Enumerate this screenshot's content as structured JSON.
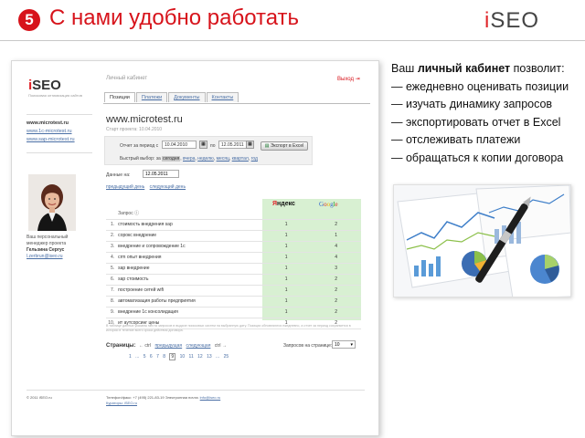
{
  "header": {
    "number": "❺",
    "title": "С нами удобно работать",
    "logo_prefix": "i",
    "logo_rest": "SEO"
  },
  "cabinet": {
    "logo_prefix": "i",
    "logo_rest": "SEO",
    "logo_sub": "Поисковая оптимизация сайтов",
    "cabinet_label": "Личный кабинет",
    "exit_label": "Выход",
    "tabs": [
      "Позиции",
      "Платежи",
      "Документы",
      "Контакты"
    ],
    "sidebar": {
      "sites": [
        "www.microtest.ru",
        "www.1c-microtest.ru",
        "www.sap-microtest.ru"
      ],
      "manager_role_1": "Ваш персональный",
      "manager_role_2": "менеджер проекта",
      "manager_name": "Гельзина Сергус",
      "manager_email": "l.zerbrun@iseo.ru"
    },
    "site_name": "www.microtest.ru",
    "start_label": "Старт проекта: 10.04.2010",
    "report": {
      "period_label": "Отчет за период с",
      "date_from": "10.04.2010",
      "to_label": "по",
      "date_to": "12.05.2011",
      "export_label": "Экспорт в Excel",
      "quick_label": "Быстрый выбор:",
      "quick_prefix": "за",
      "quick_options": [
        "сегодня",
        "вчера",
        "неделю",
        "месяц",
        "квартал",
        "год"
      ]
    },
    "data_label": "Данные на:",
    "data_date": "12.05.2011",
    "day_nav": [
      "предыдущий день",
      "следующий день"
    ],
    "table": {
      "col_query": "Запрос",
      "yandex_y": "Я",
      "yandex_rest": "ндекс",
      "google": [
        "G",
        "o",
        "o",
        "g",
        "l",
        "e"
      ],
      "rows": [
        {
          "num": "1.",
          "query": "стоимость внедрения sap",
          "yandex": "1",
          "google": "2"
        },
        {
          "num": "2.",
          "query": "сорокс внедрение",
          "yandex": "1",
          "google": "1"
        },
        {
          "num": "3.",
          "query": "внедрение и сопровождение 1с",
          "yandex": "1",
          "google": "4"
        },
        {
          "num": "4.",
          "query": "сrm опыт внедрения",
          "yandex": "1",
          "google": "4"
        },
        {
          "num": "5.",
          "query": "sap внедрение",
          "yandex": "1",
          "google": "3"
        },
        {
          "num": "6.",
          "query": "sap стоимость",
          "yandex": "1",
          "google": "2"
        },
        {
          "num": "7.",
          "query": "построение сетей wifi",
          "yandex": "1",
          "google": "2"
        },
        {
          "num": "8.",
          "query": "автоматизация работы предприятия",
          "yandex": "1",
          "google": "2"
        },
        {
          "num": "9.",
          "query": "внедрение 1с консолидация",
          "yandex": "1",
          "google": "2"
        },
        {
          "num": "10.",
          "query": "ит аутсорсинг цены",
          "yandex": "1",
          "google": "2"
        }
      ]
    },
    "footnote": "В таблице данных указаны места запросов в выдаче поисковых систем на выбранную дату. Позиции обновляются ежедневно, а отчет за период сохраняется в истории в течение всего срока действия договора.",
    "pagination": {
      "label": "Страницы:",
      "prev_arrow": "← ctrl",
      "prev": "предыдущая",
      "next": "следующая",
      "next_arrow": "ctrl →",
      "pages": "1 ... 5 6 7 8",
      "current": "9",
      "pages_after": "10 11 12 13 ... 25",
      "per_page_label": "Запросов на странице:",
      "per_page": "10"
    },
    "footer": {
      "copyright": "© 2011 iSEO.ru",
      "phone": "Телефон/факс: +7 (495) 221-83-19",
      "email_label": "Электронная почта:",
      "email": "info@iseo.ru",
      "site": "Кураторы: iSEO.ru"
    }
  },
  "benefits": {
    "intro_prefix": "Ваш",
    "intro_bold": "личный кабинет",
    "intro_suffix": "позволит:",
    "items": [
      "— ежедневно оценивать позиции",
      "— изучать динамику запросов",
      "— экспортировать отчет в Excel",
      "—  отслеживать платежи",
      "— обращаться к копии договора"
    ]
  },
  "colors": {
    "accent_red": "#d7131b",
    "link_blue": "#4a6fa5",
    "table_green": "#d8f0d2"
  }
}
